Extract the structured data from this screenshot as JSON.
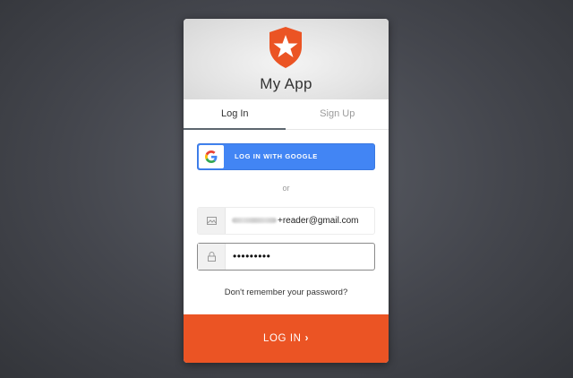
{
  "header": {
    "app_title": "My App",
    "logo_icon": "auth0-star-shield-icon",
    "logo_color": "#eb5424"
  },
  "tabs": [
    {
      "label": "Log In",
      "active": true
    },
    {
      "label": "Sign Up",
      "active": false
    }
  ],
  "social": {
    "google_label": "LOG IN WITH GOOGLE",
    "google_color": "#4285f4",
    "icon": "google-g-icon"
  },
  "divider_text": "or",
  "email": {
    "icon": "email-icon",
    "value": "+reader@gmail.com"
  },
  "password": {
    "icon": "lock-icon",
    "value": "•••••••••"
  },
  "forgot_link": "Don't remember your password?",
  "submit": {
    "label": "LOG IN",
    "icon": "chevron-right-icon",
    "color": "#eb5424"
  }
}
